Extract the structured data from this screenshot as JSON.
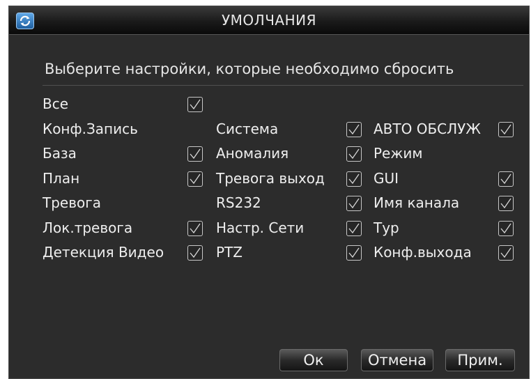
{
  "dialog": {
    "title": "УМОЛЧАНИЯ",
    "subtitle": "Выберите настройки, которые необходимо сбросить"
  },
  "options": {
    "col1": [
      {
        "label": "Все",
        "checkbox": true,
        "checked": true
      },
      {
        "label": "Конф.Запись",
        "checkbox": false
      },
      {
        "label": "База",
        "checkbox": true,
        "checked": true
      },
      {
        "label": "План",
        "checkbox": true,
        "checked": true
      },
      {
        "label": "Тревога",
        "checkbox": false
      },
      {
        "label": "Лок.тревога",
        "checkbox": true,
        "checked": true
      },
      {
        "label": "Детекция Видео",
        "checkbox": true,
        "checked": true
      }
    ],
    "col2": [
      {
        "label": "Система",
        "checked": true
      },
      {
        "label": "Аномалия",
        "checked": true
      },
      {
        "label": "Тревога выход",
        "checked": true
      },
      {
        "label": "RS232",
        "checked": true
      },
      {
        "label": "Настр. Сети",
        "checked": true
      },
      {
        "label": "PTZ",
        "checked": true
      }
    ],
    "col3": [
      {
        "label": "АВТО ОБСЛУЖ",
        "checkbox": true,
        "checked": true
      },
      {
        "label": "Режим",
        "checkbox": false
      },
      {
        "label": "GUI",
        "checkbox": true,
        "checked": true
      },
      {
        "label": "Имя канала",
        "checkbox": true,
        "checked": true
      },
      {
        "label": "Тур",
        "checkbox": true,
        "checked": true
      },
      {
        "label": "Конф.выхода",
        "checkbox": true,
        "checked": true
      }
    ]
  },
  "buttons": {
    "ok": "Ок",
    "cancel": "Отмена",
    "apply": "Прим."
  },
  "colors": {
    "background": "#2c2c2c",
    "text": "#eeeeee",
    "checkbox_border": "#c8c8c8"
  },
  "icons": {
    "title": "refresh-icon",
    "check": "checkmark-icon"
  }
}
